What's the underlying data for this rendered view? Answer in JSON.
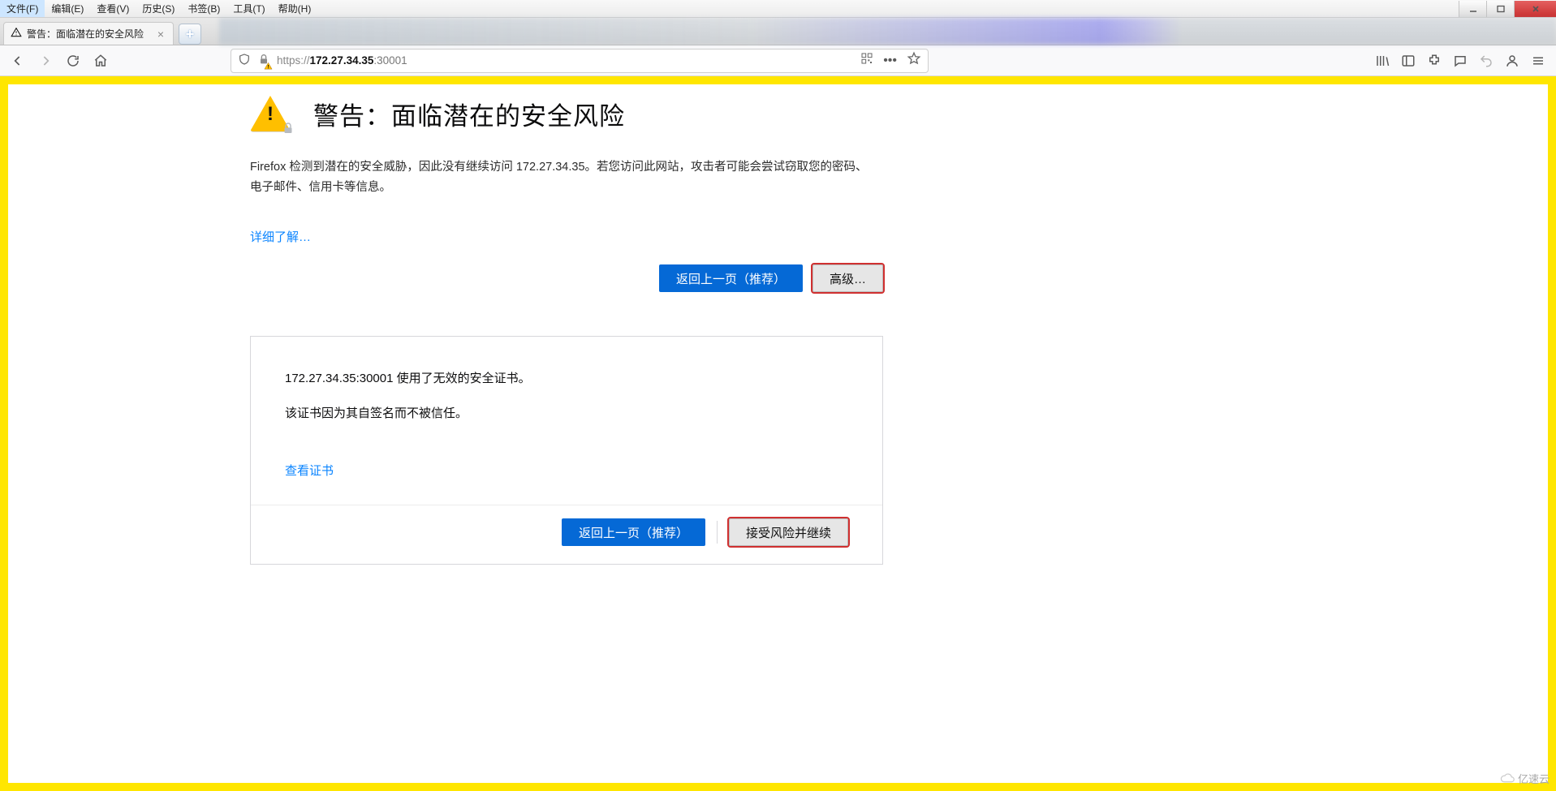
{
  "menu": {
    "file": "文件(F)",
    "edit": "编辑(E)",
    "view": "查看(V)",
    "history": "历史(S)",
    "bookmarks": "书签(B)",
    "tools": "工具(T)",
    "help": "帮助(H)"
  },
  "tab": {
    "title": "警告：面临潜在的安全风险"
  },
  "url": {
    "prefix": "https://",
    "host": "172.27.34.35",
    "port": ":30001",
    "dots": "•••"
  },
  "page": {
    "title": "警告：面临潜在的安全风险",
    "description": "Firefox 检测到潜在的安全威胁，因此没有继续访问 172.27.34.35。若您访问此网站，攻击者可能会尝试窃取您的密码、电子邮件、信用卡等信息。",
    "learn_more": "详细了解…",
    "go_back": "返回上一页（推荐）",
    "advanced": "高级…"
  },
  "cert": {
    "line1": "172.27.34.35:30001 使用了无效的安全证书。",
    "line2": "该证书因为其自签名而不被信任。",
    "view": "查看证书",
    "go_back": "返回上一页（推荐）",
    "accept": "接受风险并继续"
  },
  "watermark": "亿速云"
}
